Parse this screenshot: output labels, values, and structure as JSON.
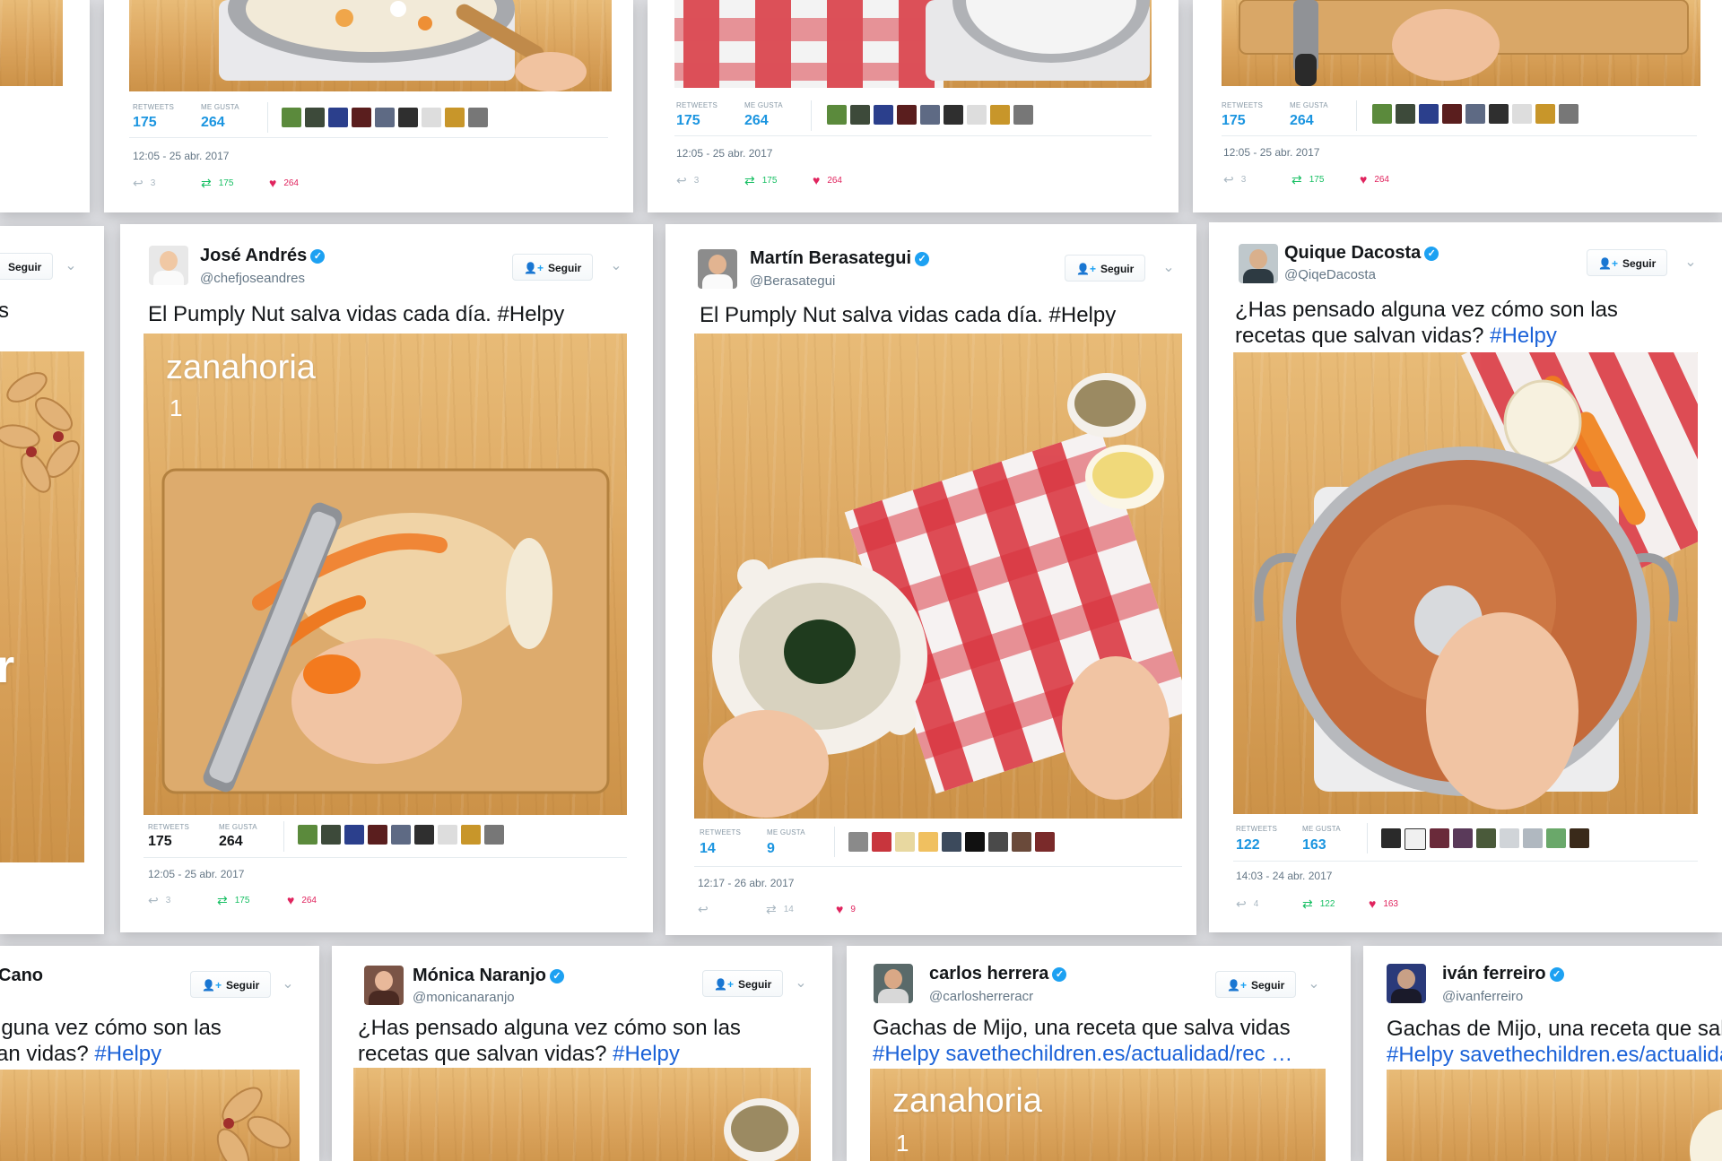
{
  "labels": {
    "retweets": "RETWEETS",
    "likes": "ME GUSTA",
    "follow": "Seguir"
  },
  "cards": {
    "c1": {
      "retweets": "175",
      "likes": "264",
      "time": "12:05 - 25 abr. 2017",
      "replies": "3",
      "rts": "175",
      "favs": "264"
    },
    "c2": {
      "retweets": "175",
      "likes": "264",
      "time": "12:05 - 25 abr. 2017",
      "replies": "3",
      "rts": "175",
      "favs": "264"
    },
    "c3": {
      "retweets": "175",
      "likes": "264",
      "time": "12:05 - 25 abr. 2017",
      "replies": "3",
      "rts": "175",
      "favs": "264"
    },
    "jose": {
      "name": "José Andrés",
      "handle": "@chefjoseandres",
      "text": "El Pumply Nut salva vidas cada día. #Helpy",
      "overlay": "zanahoria",
      "overlay_num": "1",
      "retweets": "175",
      "likes": "264",
      "time": "12:05 - 25 abr. 2017",
      "replies": "3",
      "rts": "175",
      "favs": "264"
    },
    "martin": {
      "name": "Martín Berasategui",
      "handle": "@Berasategui",
      "text": "El Pumply Nut salva vidas cada día. #Helpy",
      "retweets": "14",
      "likes": "9",
      "time": "12:17 - 26 abr. 2017",
      "rts": "14",
      "favs": "9"
    },
    "quique": {
      "name": "Quique Dacosta",
      "handle": "@QiqeDacosta",
      "text_line1": "¿Has pensado alguna vez cómo son las",
      "text_line2": "recetas que salvan vidas?",
      "hashtag": "#Helpy",
      "retweets": "122",
      "likes": "163",
      "time": "14:03 - 24 abr. 2017",
      "replies": "4",
      "rts": "122",
      "favs": "163"
    },
    "left_mid": {
      "text": "s",
      "letter": "r"
    },
    "left_bottom": {
      "name": "Cano",
      "text_line1": "lguna vez cómo son las",
      "text_line2": "an vidas?",
      "hashtag": "#Helpy"
    },
    "monica": {
      "name": "Mónica Naranjo",
      "handle": "@monicanaranjo",
      "text_line1": "¿Has pensado alguna vez cómo son las",
      "text_line2": "recetas que salvan vidas?",
      "hashtag": "#Helpy"
    },
    "carlos": {
      "name": "carlos herrera",
      "handle": "@carlosherreracr",
      "text_line1": "Gachas de Mijo, una receta que salva vidas",
      "hashtag": "#Helpy",
      "link": "savethechildren.es/actualidad/rec",
      "ellipsis": "…",
      "overlay": "zanahoria",
      "overlay_num": "1"
    },
    "ivan": {
      "name": "iván ferreiro",
      "handle": "@ivanferreiro",
      "text_line1": "Gachas de Mijo, una receta que salv",
      "hashtag": "#Helpy",
      "link": "savethechildren.es/actualida"
    }
  },
  "colors": {
    "link": "#1b62d8",
    "verified": "#1da1f2",
    "retweet": "#17bf63",
    "like": "#e0245e"
  },
  "icons": [
    "verified-badge-icon",
    "follow-person-icon",
    "chevron-down-icon",
    "reply-icon",
    "retweet-icon",
    "heart-icon"
  ]
}
